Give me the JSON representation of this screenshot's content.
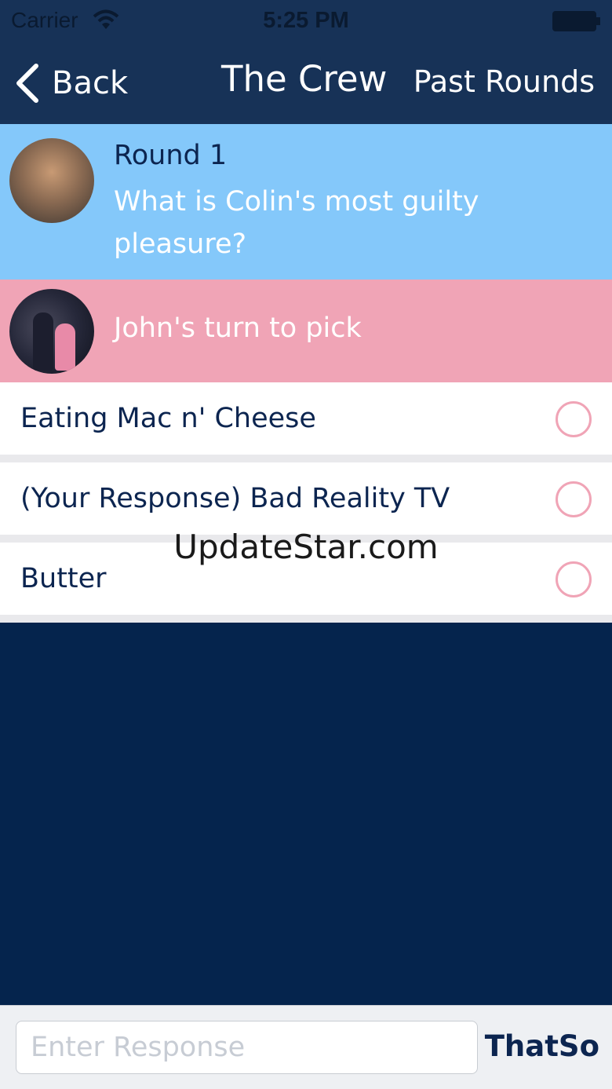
{
  "status_bar": {
    "carrier": "Carrier",
    "time": "5:25 PM",
    "wifi_icon": "wifi-icon",
    "battery_icon": "battery-icon"
  },
  "nav": {
    "back_label": "Back",
    "back_icon": "chevron-left-icon",
    "title": "The Crew",
    "subtitle": "Past Rounds"
  },
  "round": {
    "label": "Round 1",
    "question": "What is Colin's most guilty pleasure?"
  },
  "turn": {
    "text": "John's turn to pick"
  },
  "options": [
    {
      "label": "Eating Mac n' Cheese"
    },
    {
      "label": "(Your Response) Bad Reality TV"
    },
    {
      "label": "Butter"
    }
  ],
  "watermark": "UpdateStar.com",
  "composer": {
    "placeholder": "Enter Response",
    "send_label": "ThatSo"
  },
  "colors": {
    "nav_bg": "#173257",
    "round_bg": "#84c8fa",
    "turn_bg": "#f0a4b6",
    "page_bg": "#05244d",
    "text_dark": "#0c2550"
  }
}
